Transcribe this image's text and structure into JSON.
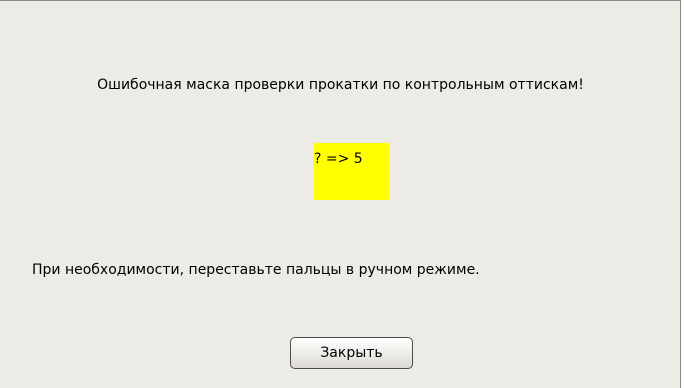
{
  "dialog": {
    "message": "Ошибочная маска проверки прокатки по контрольным оттискам!",
    "code": "? => 5",
    "hint": "При необходимости, переставьте пальцы в ручном режиме.",
    "close_label": "Закрыть"
  },
  "colors": {
    "background": "#edebe6",
    "highlight": "#ffff00"
  }
}
